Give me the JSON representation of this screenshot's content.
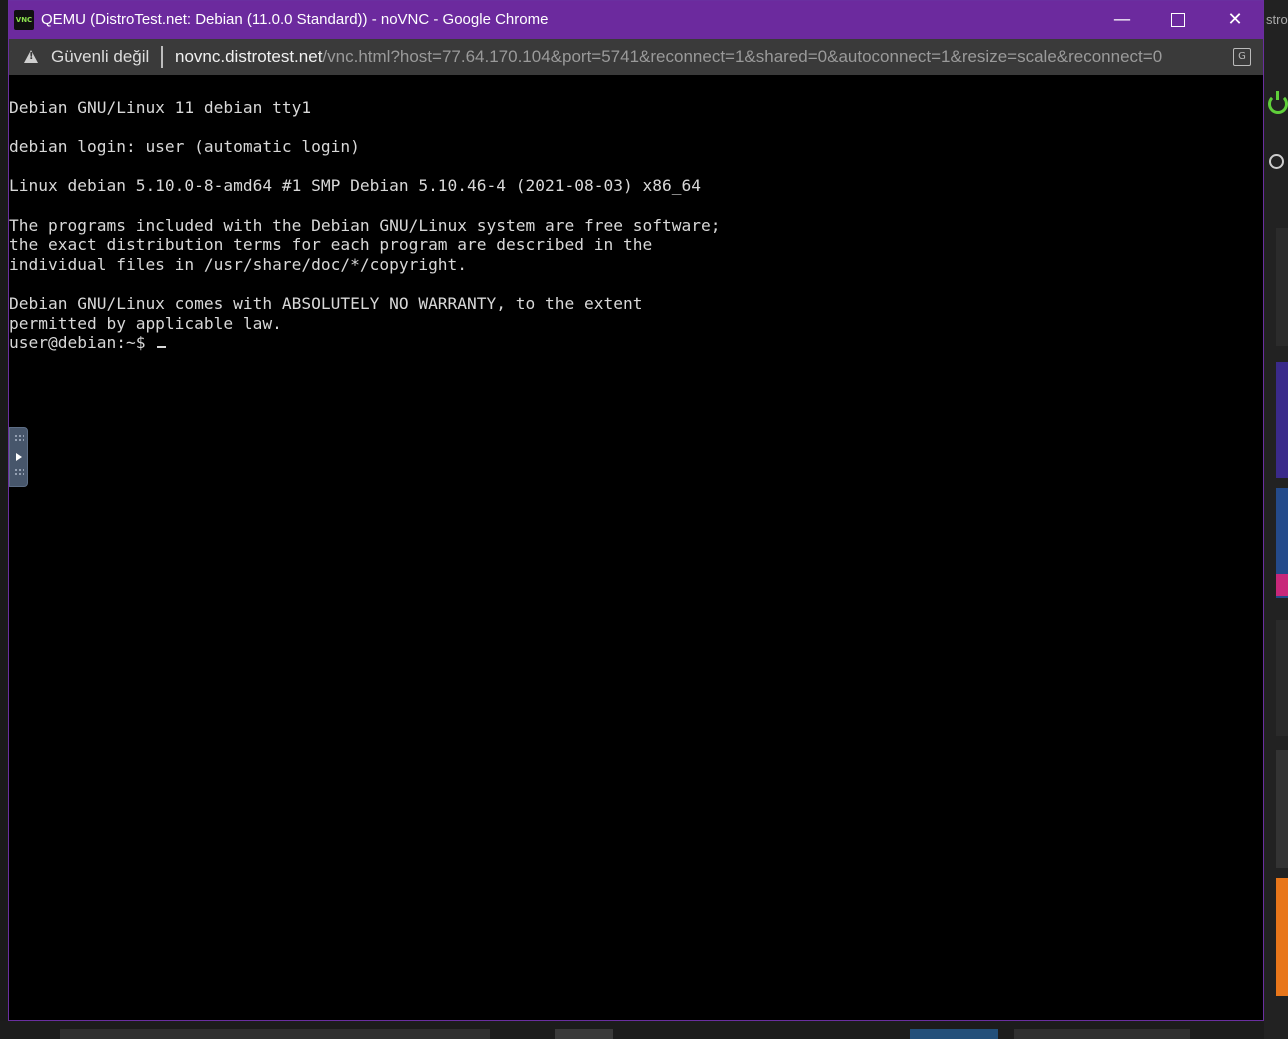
{
  "window": {
    "title": "QEMU (DistroTest.net: Debian (11.0.0 Standard)) - noVNC - Google Chrome",
    "app_icon_text": "VNC",
    "minimize_glyph": "—",
    "close_glyph": "✕"
  },
  "addressbar": {
    "security_label": "Güvenli değil",
    "url_host": "novnc.distrotest.net",
    "url_path": "/vnc.html?host=77.64.170.104&port=5741&reconnect=1&shared=0&autoconnect=1&resize=scale&reconnect=0"
  },
  "background_page": {
    "partial_text": "stro"
  },
  "terminal": {
    "lines": [
      "Debian GNU/Linux 11 debian tty1",
      "",
      "debian login: user (automatic login)",
      "",
      "Linux debian 5.10.0-8-amd64 #1 SMP Debian 5.10.46-4 (2021-08-03) x86_64",
      "",
      "The programs included with the Debian GNU/Linux system are free software;",
      "the exact distribution terms for each program are described in the",
      "individual files in /usr/share/doc/*/copyright.",
      "",
      "Debian GNU/Linux comes with ABSOLUTELY NO WARRANTY, to the extent",
      "permitted by applicable law."
    ],
    "prompt": "user@debian:~$ "
  },
  "colors": {
    "titlebar": "#6c2a9e",
    "addressbar": "#3a3a3a",
    "terminal_bg": "#000000",
    "terminal_fg": "#d8d8d8"
  }
}
